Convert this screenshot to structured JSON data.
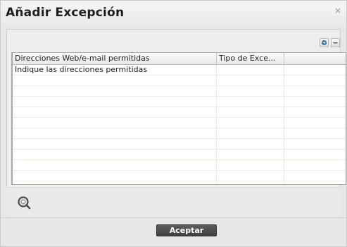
{
  "dialog": {
    "title": "Añadir Excepción",
    "close_glyph": "×"
  },
  "toolbar": {
    "add_icon": "plus-icon",
    "remove_icon": "minus-icon"
  },
  "grid": {
    "columns": [
      "Direcciones Web/e-mail permitidas",
      "Tipo de Exce...",
      ""
    ],
    "rows": [
      [
        "Indique las direcciones permitidas",
        "",
        ""
      ],
      [
        "",
        "",
        ""
      ],
      [
        "",
        "",
        ""
      ],
      [
        "",
        "",
        ""
      ],
      [
        "",
        "",
        ""
      ],
      [
        "",
        "",
        ""
      ],
      [
        "",
        "",
        ""
      ],
      [
        "",
        "",
        ""
      ],
      [
        "",
        "",
        ""
      ],
      [
        "",
        "",
        ""
      ],
      [
        "",
        "",
        ""
      ],
      [
        "",
        "",
        ""
      ]
    ]
  },
  "footer": {
    "help_icon": "help-magnifier-icon",
    "accept_label": "Aceptar"
  }
}
